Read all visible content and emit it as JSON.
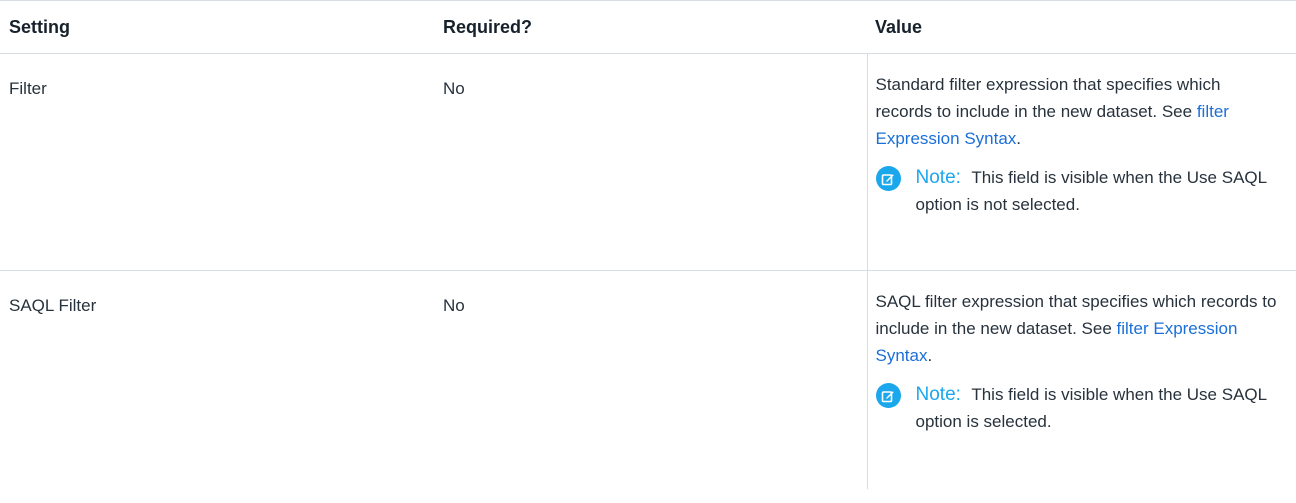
{
  "table": {
    "headers": [
      "Setting",
      "Required?",
      "Value"
    ],
    "rows": [
      {
        "setting": "Filter",
        "required": "No",
        "value_text": "Standard filter expression that specifies which records to include in the new dataset. See",
        "link_text": "filter Expression Syntax",
        "after_link": ".",
        "note_label": "Note:",
        "note_text": "This field is visible when the Use SAQL option is not selected."
      },
      {
        "setting": "SAQL Filter",
        "required": "No",
        "value_text": "SAQL filter expression that specifies which records to include in the new dataset. See",
        "link_text": "filter Expression Syntax",
        "after_link": ".",
        "note_label": "Note:",
        "note_text": "This field is visible when the Use SAQL option is selected."
      }
    ]
  },
  "icons": {
    "note": "edit-note-icon"
  },
  "colors": {
    "link": "#1b6fd8",
    "note_accent": "#1ba7ec",
    "border": "#d8dde3"
  }
}
